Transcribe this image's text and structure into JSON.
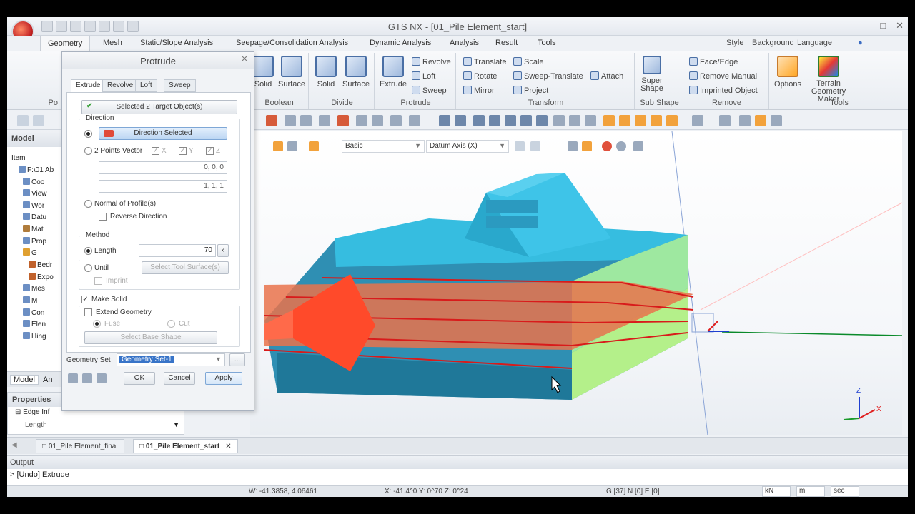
{
  "window": {
    "title": "GTS NX - [01_Pile Element_start]"
  },
  "menu": {
    "tabs": [
      "Geometry",
      "Mesh",
      "Static/Slope Analysis",
      "Seepage/Consolidation Analysis",
      "Dynamic Analysis",
      "Analysis",
      "Result",
      "Tools"
    ],
    "right": [
      "Style",
      "Background",
      "Language"
    ]
  },
  "ribbon": {
    "boolean": {
      "label": "Boolean",
      "solid": "Solid",
      "surface": "Surface"
    },
    "divide": {
      "label": "Divide",
      "solid": "Solid",
      "surface": "Surface"
    },
    "protrude": {
      "label": "Protrude",
      "extrude": "Extrude",
      "revolve": "Revolve",
      "loft": "Loft",
      "sweep": "Sweep"
    },
    "transform": {
      "label": "Transform",
      "translate": "Translate",
      "scale": "Scale",
      "rotate": "Rotate",
      "sweep_translate": "Sweep-Translate",
      "attach": "Attach",
      "mirror": "Mirror",
      "project": "Project"
    },
    "subshape": {
      "label": "Sub Shape",
      "super_shape": "Super Shape"
    },
    "remove": {
      "label": "Remove",
      "face_edge": "Face/Edge",
      "remove_manual": "Remove Manual",
      "imprinted": "Imprinted Object"
    },
    "tools": {
      "label": "Tools",
      "options": "Options",
      "terrain": "Terrain Geometry Maker"
    },
    "partial_po": "Po"
  },
  "model": {
    "header": "Model",
    "col": "Item",
    "items": [
      "F:\\01 Ab",
      "Coo",
      "View",
      "Wor",
      "Datu",
      "Mat",
      "Prop",
      "G",
      "Bedr",
      "Expo",
      "Mes",
      "M",
      "Con",
      "Elen",
      "Hing"
    ],
    "tabs": [
      "Model",
      "An"
    ]
  },
  "properties": {
    "header": "Properties",
    "group": "Edge Inf",
    "row": "Length"
  },
  "viewport": {
    "select1": "Basic",
    "select2": "Datum Axis (X)",
    "axis_z": "Z",
    "axis_x": "X"
  },
  "dialog": {
    "title": "Protrude",
    "tabs": [
      "Extrude",
      "Revolve",
      "Loft",
      "Sweep"
    ],
    "target": "Selected 2 Target Object(s)",
    "direction_label": "Direction",
    "direction_selected": "Direction Selected",
    "two_points": "2 Points Vector",
    "x": "X",
    "y": "Y",
    "z": "Z",
    "pt1": "0, 0, 0",
    "pt2": "1, 1, 1",
    "normal": "Normal of Profile(s)",
    "reverse": "Reverse Direction",
    "method_label": "Method",
    "length": "Length",
    "length_value": "70",
    "until": "Until",
    "select_tool": "Select Tool Surface(s)",
    "imprint": "Imprint",
    "make_solid": "Make Solid",
    "extend_geometry": "Extend Geometry",
    "fuse": "Fuse",
    "cut": "Cut",
    "select_base": "Select Base Shape",
    "geometry_set_label": "Geometry Set",
    "geometry_set_value": "Geometry Set-1",
    "ok": "OK",
    "cancel": "Cancel",
    "apply": "Apply"
  },
  "doc_tabs": [
    "01_Pile Element_final",
    "01_Pile Element_start"
  ],
  "output": {
    "header": "Output",
    "line": "> [Undo] Extrude"
  },
  "status": {
    "w": "W: -41.3858, 4.06461",
    "xyz": "X: -41.4^0 Y: 0^70 Z: 0^24",
    "g": "G [37] N [0] E [0]",
    "units": [
      "kN",
      "m",
      "sec"
    ]
  }
}
